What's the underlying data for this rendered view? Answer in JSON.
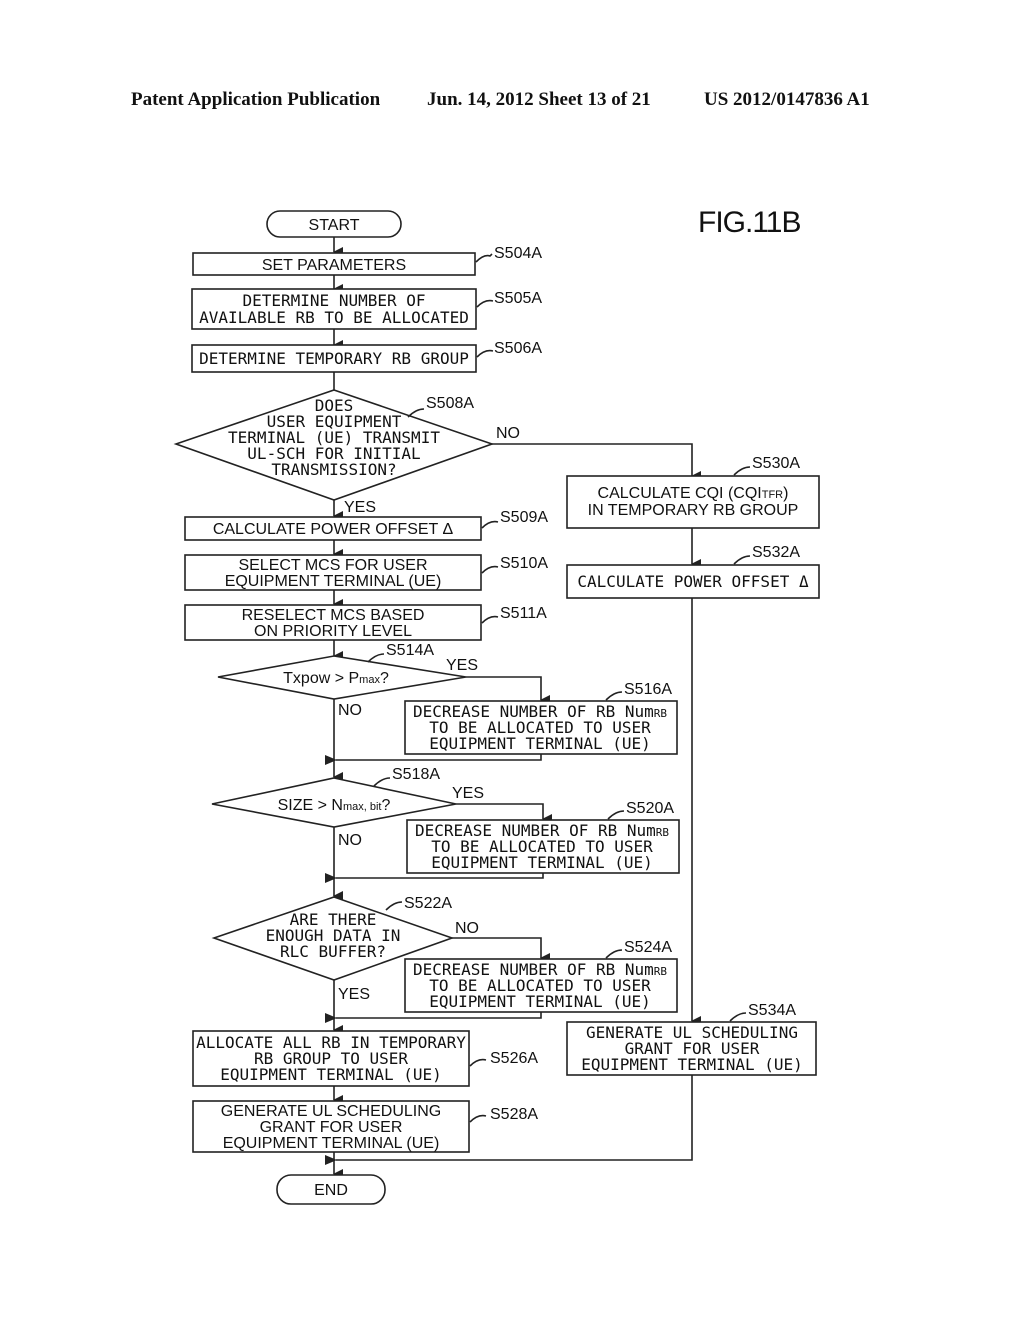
{
  "header": {
    "publication": "Patent Application Publication",
    "date_sheet": "Jun. 14, 2012  Sheet 13 of 21",
    "number": "US 2012/0147836 A1"
  },
  "figure_label": "FIG.11B",
  "terminals": {
    "start": "START",
    "end": "END"
  },
  "steps": {
    "s504a": {
      "id": "S504A",
      "lines": [
        "SET PARAMETERS"
      ]
    },
    "s505a": {
      "id": "S505A",
      "lines": [
        "DETERMINE NUMBER OF",
        "AVAILABLE RB TO BE ALLOCATED"
      ]
    },
    "s506a": {
      "id": "S506A",
      "lines": [
        "DETERMINE TEMPORARY RB GROUP"
      ]
    },
    "s508a": {
      "id": "S508A",
      "lines": [
        "DOES",
        "USER EQUIPMENT",
        "TERMINAL (UE) TRANSMIT",
        "UL-SCH FOR INITIAL",
        "TRANSMISSION?"
      ]
    },
    "s509a": {
      "id": "S509A",
      "lines": [
        "CALCULATE POWER OFFSET Δ"
      ]
    },
    "s510a": {
      "id": "S510A",
      "lines": [
        "SELECT MCS FOR USER",
        "EQUIPMENT TERMINAL (UE)"
      ]
    },
    "s511a": {
      "id": "S511A",
      "lines": [
        "RESELECT MCS BASED",
        "ON PRIORITY LEVEL"
      ]
    },
    "s514a": {
      "id": "S514A",
      "main": "Txpow > P",
      "sub": "max",
      "tail": "?"
    },
    "s516a": {
      "id": "S516A",
      "lines": [
        "DECREASE NUMBER OF RB Num",
        "TO BE ALLOCATED TO USER",
        "EQUIPMENT TERMINAL (UE)"
      ],
      "sub": "RB"
    },
    "s518a": {
      "id": "S518A",
      "main": "SIZE > N",
      "sub": "max, bit",
      "tail": "?"
    },
    "s520a": {
      "id": "S520A",
      "lines": [
        "DECREASE NUMBER OF RB Num",
        "TO BE ALLOCATED TO USER",
        "EQUIPMENT TERMINAL (UE)"
      ],
      "sub": "RB"
    },
    "s522a": {
      "id": "S522A",
      "lines": [
        "ARE THERE",
        "ENOUGH DATA IN",
        "RLC BUFFER?"
      ]
    },
    "s524a": {
      "id": "S524A",
      "lines": [
        "DECREASE NUMBER OF RB Num",
        "TO BE ALLOCATED TO USER",
        "EQUIPMENT TERMINAL (UE)"
      ],
      "sub": "RB"
    },
    "s526a": {
      "id": "S526A",
      "lines": [
        "ALLOCATE ALL RB IN TEMPORARY",
        "RB GROUP TO USER",
        "EQUIPMENT TERMINAL (UE)"
      ]
    },
    "s528a": {
      "id": "S528A",
      "lines": [
        "GENERATE UL SCHEDULING",
        "GRANT FOR USER",
        "EQUIPMENT TERMINAL (UE)"
      ]
    },
    "s530a": {
      "id": "S530A",
      "lines": [
        "CALCULATE CQI (CQI",
        "IN TEMPORARY RB GROUP"
      ],
      "sub": "TFR",
      "tail": ")"
    },
    "s532a": {
      "id": "S532A",
      "lines": [
        "CALCULATE POWER OFFSET Δ"
      ]
    },
    "s534a": {
      "id": "S534A",
      "lines": [
        "GENERATE UL SCHEDULING",
        "GRANT FOR USER",
        "EQUIPMENT TERMINAL (UE)"
      ]
    }
  },
  "branch_labels": {
    "yes": "YES",
    "no": "NO"
  }
}
